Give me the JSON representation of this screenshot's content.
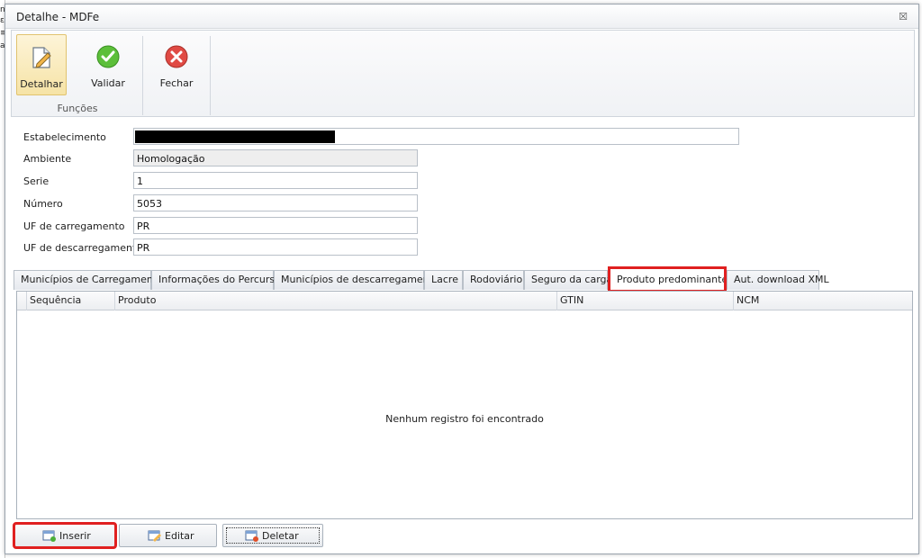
{
  "window": {
    "title": "Detalhe - MDFe",
    "close_glyph": "☒"
  },
  "ribbon": {
    "buttons": [
      {
        "label": "Detalhar",
        "icon": "edit-page-icon"
      },
      {
        "label": "Validar",
        "icon": "check-circle-icon"
      },
      {
        "label": "Fechar",
        "icon": "close-circle-icon"
      }
    ],
    "group_label": "Funções"
  },
  "form": {
    "estabelecimento": {
      "label": "Estabelecimento",
      "value": ""
    },
    "ambiente": {
      "label": "Ambiente",
      "value": "Homologação"
    },
    "serie": {
      "label": "Serie",
      "value": "1"
    },
    "numero": {
      "label": "Número",
      "value": "5053"
    },
    "uf_carregamento": {
      "label": "UF de carregamento",
      "value": "PR"
    },
    "uf_descarregamento": {
      "label": "UF de descarregamento",
      "value": "PR"
    }
  },
  "tabs": [
    {
      "label": "Municípios de Carregamento"
    },
    {
      "label": "Informações do Percurso"
    },
    {
      "label": "Municípios de descarregamento"
    },
    {
      "label": "Lacre"
    },
    {
      "label": "Rodoviário"
    },
    {
      "label": "Seguro da carga"
    },
    {
      "label": "Produto predominante"
    },
    {
      "label": "Aut. download XML"
    }
  ],
  "active_tab": "Produto predominante",
  "grid": {
    "columns": [
      "Sequência",
      "Produto",
      "GTIN",
      "NCM"
    ],
    "rows": [],
    "empty_message": "Nenhum registro foi encontrado"
  },
  "actions": {
    "insert": "Inserir",
    "edit": "Editar",
    "delete": "Deletar"
  },
  "colors": {
    "highlight": "#e02020",
    "active_ribbon": "#f6e3a6"
  }
}
